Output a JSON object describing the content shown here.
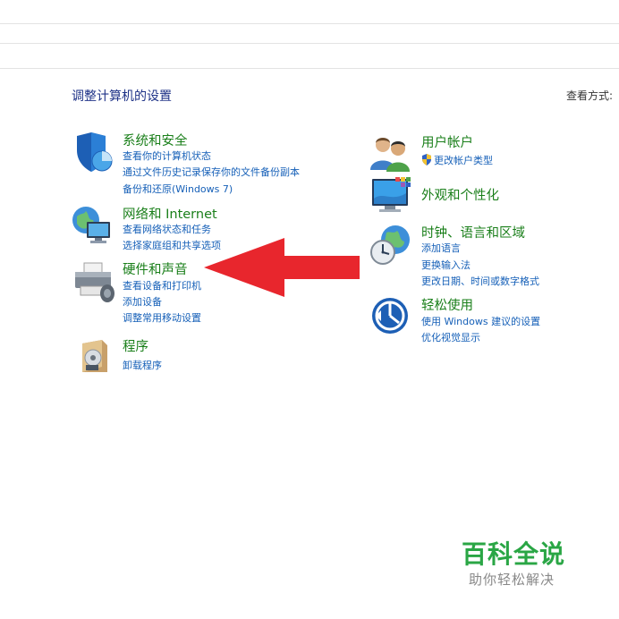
{
  "header": {
    "title": "调整计算机的设置",
    "view_by_label": "查看方式:"
  },
  "left_categories": [
    {
      "title": "系统和安全",
      "icon": "shield-icon",
      "links": [
        "查看你的计算机状态",
        "通过文件历史记录保存你的文件备份副本",
        "备份和还原(Windows 7)"
      ]
    },
    {
      "title": "网络和 Internet",
      "icon": "network-icon",
      "links": [
        "查看网络状态和任务",
        "选择家庭组和共享选项"
      ]
    },
    {
      "title": "硬件和声音",
      "icon": "printer-icon",
      "links": [
        "查看设备和打印机",
        "添加设备",
        "调整常用移动设置"
      ]
    },
    {
      "title": "程序",
      "icon": "programs-icon",
      "links": [
        "卸载程序"
      ]
    }
  ],
  "right_categories": [
    {
      "title": "用户帐户",
      "icon": "users-icon",
      "links": [
        "更改帐户类型"
      ]
    },
    {
      "title": "外观和个性化",
      "icon": "personalization-icon",
      "links": []
    },
    {
      "title": "时钟、语言和区域",
      "icon": "clock-globe-icon",
      "links": [
        "添加语言",
        "更换输入法",
        "更改日期、时间或数字格式"
      ]
    },
    {
      "title": "轻松使用",
      "icon": "ease-of-access-icon",
      "links": [
        "使用 Windows 建议的设置",
        "优化视觉显示"
      ]
    }
  ],
  "annotation": {
    "arrow_color": "#e8262d"
  },
  "watermark": {
    "title": "百科全说",
    "subtitle": "助你轻松解决"
  }
}
